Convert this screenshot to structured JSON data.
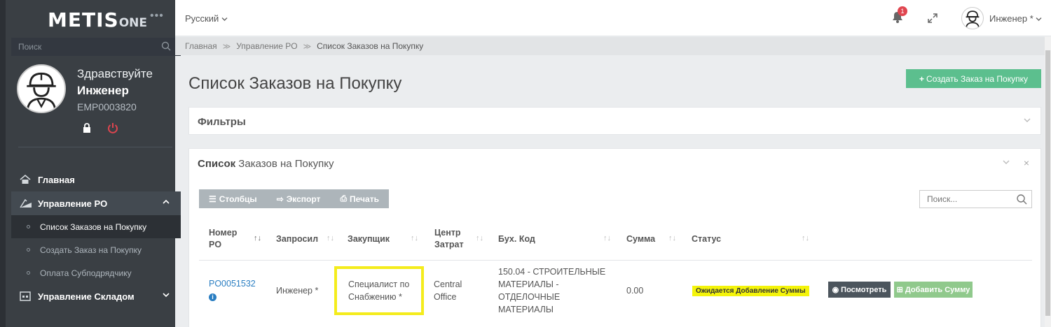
{
  "brand": {
    "logo_main": "METIS",
    "logo_suffix": "ONE"
  },
  "sidebar": {
    "search_placeholder": "Поиск",
    "profile": {
      "greeting": "Здравствуйте",
      "name": "Инженер",
      "employee_id": "EMP0003820"
    },
    "nav": [
      {
        "label": "Главная",
        "icon": "home-icon"
      },
      {
        "label": "Управление PO",
        "icon": "po-icon",
        "expanded": true,
        "children": [
          {
            "label": "Список Заказов на Покупку",
            "active": true
          },
          {
            "label": "Создать Заказ на Покупку"
          },
          {
            "label": "Оплата Субподрядчику"
          }
        ]
      },
      {
        "label": "Управление Складом",
        "icon": "warehouse-icon",
        "expanded": false
      }
    ]
  },
  "topbar": {
    "language": "Русский",
    "notification_count": "1",
    "user_name": "Инженер *"
  },
  "breadcrumb": [
    "Главная",
    "Управление PO",
    "Список Заказов на Покупку"
  ],
  "page": {
    "title": "Список Заказов на Покупку",
    "create_button": "Создать Заказ на Покупку",
    "filters_title": "Фильтры",
    "list_title_bold": "Список",
    "list_title_rest": " Заказов на Покупку"
  },
  "toolbar": {
    "columns": "Столбцы",
    "export": "Экспорт",
    "print": "Печать",
    "search_placeholder": "Поиск..."
  },
  "table": {
    "headers": {
      "po_number": "Номер PO",
      "requested_by": "Запросил",
      "buyer": "Закупщик",
      "cost_center": "Центр Затрат",
      "account_code": "Бух. Код",
      "amount": "Сумма",
      "status": "Статус"
    },
    "rows": [
      {
        "po_number": "PO0051532",
        "requested_by": "Инженер *",
        "buyer": "Специалист по Снабжению *",
        "cost_center": "Central Office",
        "account_code": "150.04 - СТРОИТЕЛЬНЫЕ МАТЕРИАЛЫ - ОТДЕЛОЧНЫЕ МАТЕРИАЛЫ",
        "amount": "0.00",
        "status": "Ожидается Добавление Суммы",
        "view_button": "Посмотреть",
        "add_sum_button": "Добавить Сумму"
      }
    ]
  },
  "colors": {
    "sidebar": "#3a3f44",
    "accent_green": "#5cbf8e",
    "status_yellow": "#f4f40a",
    "link_blue": "#2a7ec2"
  }
}
